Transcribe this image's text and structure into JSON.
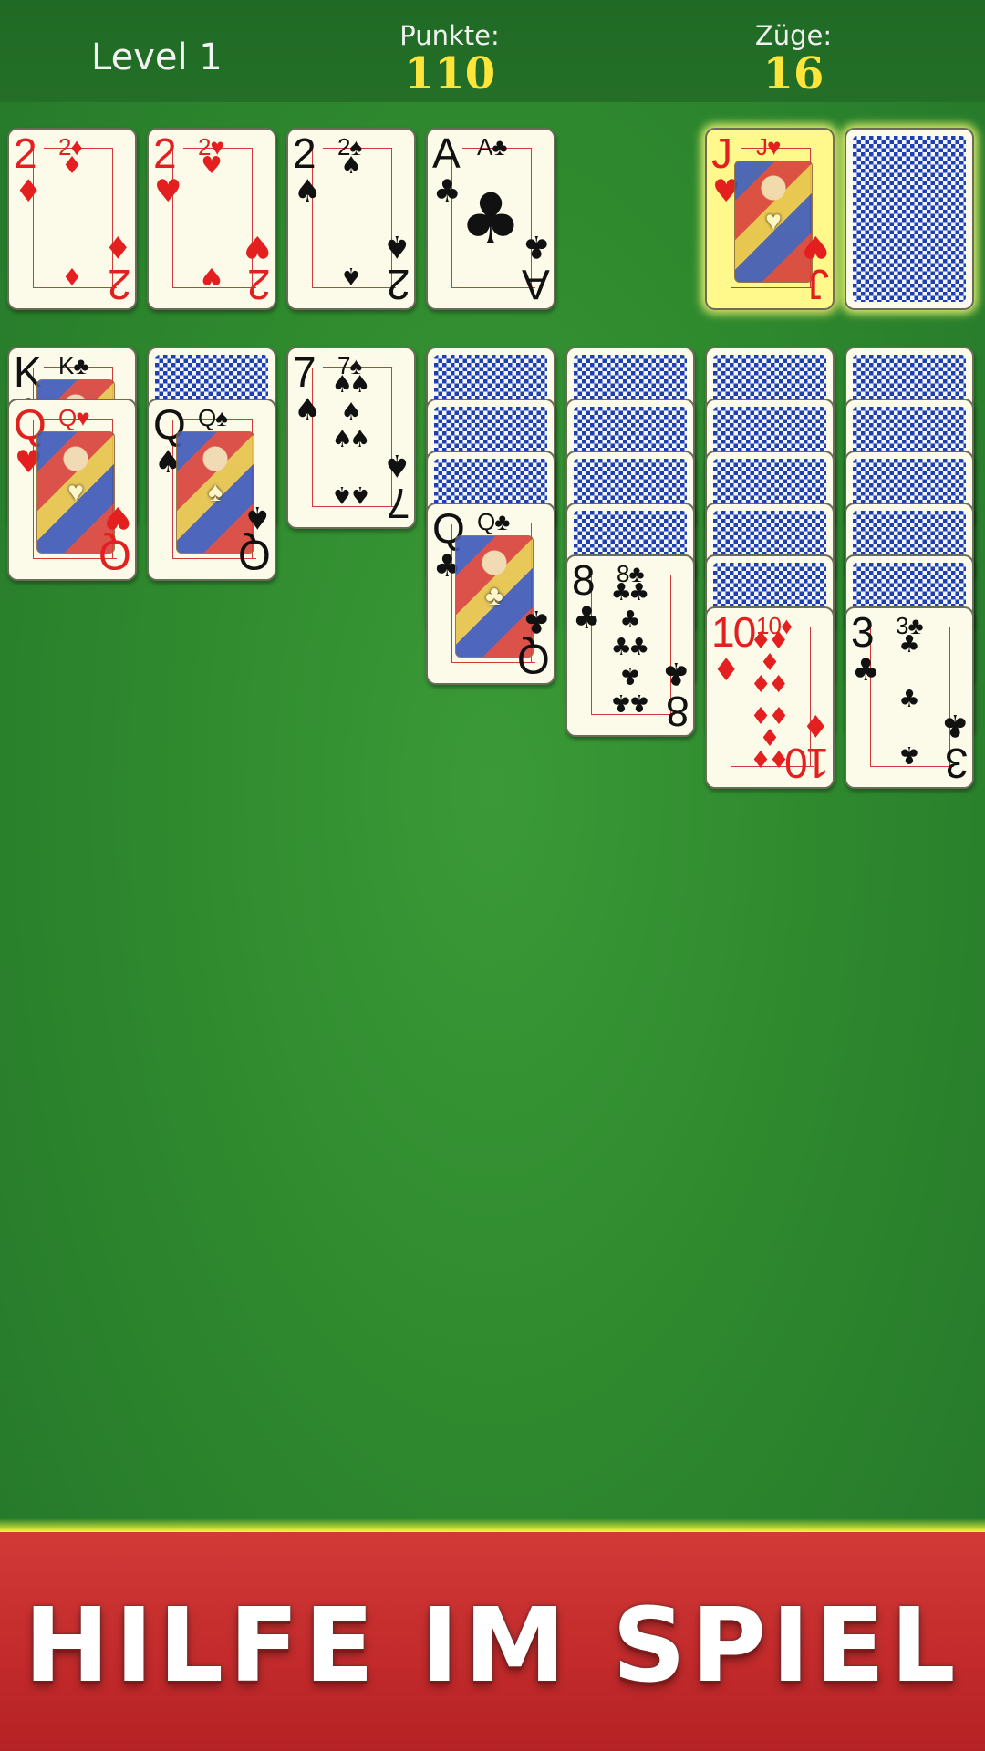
{
  "header": {
    "level_label": "Level 1",
    "score_label": "Punkte:",
    "score_value": "110",
    "moves_label": "Züge:",
    "moves_value": "16"
  },
  "foundations": [
    {
      "rank": "2",
      "suit": "♦",
      "color": "red"
    },
    {
      "rank": "2",
      "suit": "♥",
      "color": "red"
    },
    {
      "rank": "2",
      "suit": "♠",
      "color": "black"
    },
    {
      "rank": "A",
      "suit": "♣",
      "color": "black"
    }
  ],
  "waste": {
    "rank": "J",
    "suit": "♥",
    "color": "red",
    "highlighted": true
  },
  "stock": {
    "face_down": true
  },
  "tableau": [
    {
      "face_down": 0,
      "cards": [
        {
          "rank": "K",
          "suit": "♣",
          "color": "black"
        },
        {
          "rank": "Q",
          "suit": "♥",
          "color": "red"
        }
      ]
    },
    {
      "face_down": 1,
      "cards": [
        {
          "rank": "Q",
          "suit": "♠",
          "color": "black"
        }
      ]
    },
    {
      "face_down": 0,
      "cards": [
        {
          "rank": "7",
          "suit": "♠",
          "color": "black"
        }
      ]
    },
    {
      "face_down": 3,
      "cards": [
        {
          "rank": "Q",
          "suit": "♣",
          "color": "black"
        }
      ]
    },
    {
      "face_down": 4,
      "cards": [
        {
          "rank": "8",
          "suit": "♣",
          "color": "black"
        }
      ]
    },
    {
      "face_down": 5,
      "cards": [
        {
          "rank": "10",
          "suit": "♦",
          "color": "red"
        }
      ]
    },
    {
      "face_down": 5,
      "cards": [
        {
          "rank": "3",
          "suit": "♣",
          "color": "black"
        }
      ]
    }
  ],
  "banner": {
    "text": "HILFE IM SPIEL"
  },
  "colors": {
    "felt": "#2f8a2e",
    "header": "#246f28",
    "score": "#ffe53a",
    "banner": "#c22a2b",
    "card_back": "#1d3fb0"
  }
}
